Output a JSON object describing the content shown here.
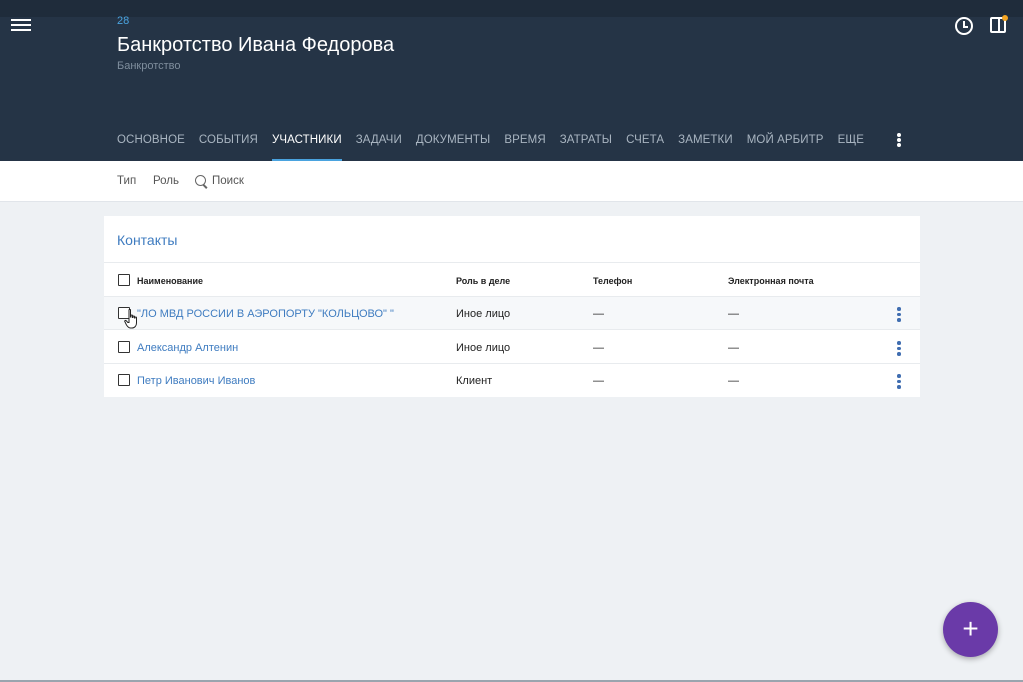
{
  "header": {
    "case_number": "28",
    "case_title": "Банкротство Ивана Федорова",
    "case_subtitle": "Банкротство"
  },
  "tabs": [
    {
      "label": "ОСНОВНОЕ",
      "active": false
    },
    {
      "label": "СОБЫТИЯ",
      "active": false
    },
    {
      "label": "УЧАСТНИКИ",
      "active": true
    },
    {
      "label": "ЗАДАЧИ",
      "active": false
    },
    {
      "label": "ДОКУМЕНТЫ",
      "active": false
    },
    {
      "label": "ВРЕМЯ",
      "active": false
    },
    {
      "label": "ЗАТРАТЫ",
      "active": false
    },
    {
      "label": "СЧЕТА",
      "active": false
    },
    {
      "label": "ЗАМЕТКИ",
      "active": false
    },
    {
      "label": "МОЙ АРБИТР",
      "active": false
    },
    {
      "label": "ЕЩЕ",
      "active": false
    }
  ],
  "filters": {
    "type_label": "Тип",
    "role_label": "Роль",
    "search_placeholder": "Поиск"
  },
  "contacts": {
    "title": "Контакты",
    "columns": {
      "name": "Наименование",
      "role": "Роль в деле",
      "phone": "Телефон",
      "email": "Электронная почта"
    },
    "rows": [
      {
        "name": "\"ЛО МВД РОССИИ В АЭРОПОРТУ \"КОЛЬЦОВО\" \"",
        "role": "Иное лицо",
        "phone": "—",
        "email": "—"
      },
      {
        "name": "Александр Алтенин",
        "role": "Иное лицо",
        "phone": "—",
        "email": "—"
      },
      {
        "name": "Петр Иванович Иванов",
        "role": "Клиент",
        "phone": "—",
        "email": "—"
      }
    ]
  },
  "fab": {
    "label": "+"
  },
  "icons": {
    "menu": "hamburger-menu-icon",
    "history": "clock-icon",
    "panel": "side-panel-icon",
    "more": "more-vertical-icon",
    "search": "search-icon",
    "add": "plus-icon"
  },
  "colors": {
    "header_bg": "#253446",
    "accent_blue": "#4aa3df",
    "link_blue": "#3f7cc0",
    "fab_purple": "#6a3aa8",
    "notification": "#f5a623"
  }
}
